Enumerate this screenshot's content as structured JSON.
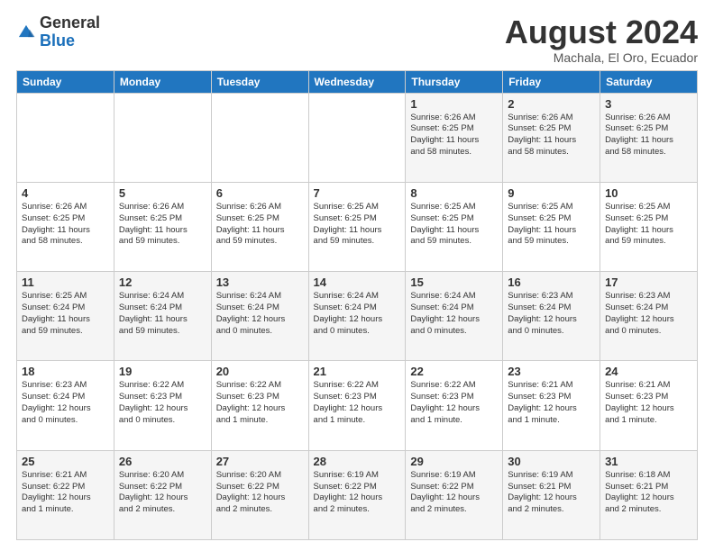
{
  "header": {
    "logo_general": "General",
    "logo_blue": "Blue",
    "month_title": "August 2024",
    "location": "Machala, El Oro, Ecuador"
  },
  "days_of_week": [
    "Sunday",
    "Monday",
    "Tuesday",
    "Wednesday",
    "Thursday",
    "Friday",
    "Saturday"
  ],
  "weeks": [
    [
      {
        "day": "",
        "info": ""
      },
      {
        "day": "",
        "info": ""
      },
      {
        "day": "",
        "info": ""
      },
      {
        "day": "",
        "info": ""
      },
      {
        "day": "1",
        "info": "Sunrise: 6:26 AM\nSunset: 6:25 PM\nDaylight: 11 hours\nand 58 minutes."
      },
      {
        "day": "2",
        "info": "Sunrise: 6:26 AM\nSunset: 6:25 PM\nDaylight: 11 hours\nand 58 minutes."
      },
      {
        "day": "3",
        "info": "Sunrise: 6:26 AM\nSunset: 6:25 PM\nDaylight: 11 hours\nand 58 minutes."
      }
    ],
    [
      {
        "day": "4",
        "info": "Sunrise: 6:26 AM\nSunset: 6:25 PM\nDaylight: 11 hours\nand 58 minutes."
      },
      {
        "day": "5",
        "info": "Sunrise: 6:26 AM\nSunset: 6:25 PM\nDaylight: 11 hours\nand 59 minutes."
      },
      {
        "day": "6",
        "info": "Sunrise: 6:26 AM\nSunset: 6:25 PM\nDaylight: 11 hours\nand 59 minutes."
      },
      {
        "day": "7",
        "info": "Sunrise: 6:25 AM\nSunset: 6:25 PM\nDaylight: 11 hours\nand 59 minutes."
      },
      {
        "day": "8",
        "info": "Sunrise: 6:25 AM\nSunset: 6:25 PM\nDaylight: 11 hours\nand 59 minutes."
      },
      {
        "day": "9",
        "info": "Sunrise: 6:25 AM\nSunset: 6:25 PM\nDaylight: 11 hours\nand 59 minutes."
      },
      {
        "day": "10",
        "info": "Sunrise: 6:25 AM\nSunset: 6:25 PM\nDaylight: 11 hours\nand 59 minutes."
      }
    ],
    [
      {
        "day": "11",
        "info": "Sunrise: 6:25 AM\nSunset: 6:24 PM\nDaylight: 11 hours\nand 59 minutes."
      },
      {
        "day": "12",
        "info": "Sunrise: 6:24 AM\nSunset: 6:24 PM\nDaylight: 11 hours\nand 59 minutes."
      },
      {
        "day": "13",
        "info": "Sunrise: 6:24 AM\nSunset: 6:24 PM\nDaylight: 12 hours\nand 0 minutes."
      },
      {
        "day": "14",
        "info": "Sunrise: 6:24 AM\nSunset: 6:24 PM\nDaylight: 12 hours\nand 0 minutes."
      },
      {
        "day": "15",
        "info": "Sunrise: 6:24 AM\nSunset: 6:24 PM\nDaylight: 12 hours\nand 0 minutes."
      },
      {
        "day": "16",
        "info": "Sunrise: 6:23 AM\nSunset: 6:24 PM\nDaylight: 12 hours\nand 0 minutes."
      },
      {
        "day": "17",
        "info": "Sunrise: 6:23 AM\nSunset: 6:24 PM\nDaylight: 12 hours\nand 0 minutes."
      }
    ],
    [
      {
        "day": "18",
        "info": "Sunrise: 6:23 AM\nSunset: 6:24 PM\nDaylight: 12 hours\nand 0 minutes."
      },
      {
        "day": "19",
        "info": "Sunrise: 6:22 AM\nSunset: 6:23 PM\nDaylight: 12 hours\nand 0 minutes."
      },
      {
        "day": "20",
        "info": "Sunrise: 6:22 AM\nSunset: 6:23 PM\nDaylight: 12 hours\nand 1 minute."
      },
      {
        "day": "21",
        "info": "Sunrise: 6:22 AM\nSunset: 6:23 PM\nDaylight: 12 hours\nand 1 minute."
      },
      {
        "day": "22",
        "info": "Sunrise: 6:22 AM\nSunset: 6:23 PM\nDaylight: 12 hours\nand 1 minute."
      },
      {
        "day": "23",
        "info": "Sunrise: 6:21 AM\nSunset: 6:23 PM\nDaylight: 12 hours\nand 1 minute."
      },
      {
        "day": "24",
        "info": "Sunrise: 6:21 AM\nSunset: 6:23 PM\nDaylight: 12 hours\nand 1 minute."
      }
    ],
    [
      {
        "day": "25",
        "info": "Sunrise: 6:21 AM\nSunset: 6:22 PM\nDaylight: 12 hours\nand 1 minute."
      },
      {
        "day": "26",
        "info": "Sunrise: 6:20 AM\nSunset: 6:22 PM\nDaylight: 12 hours\nand 2 minutes."
      },
      {
        "day": "27",
        "info": "Sunrise: 6:20 AM\nSunset: 6:22 PM\nDaylight: 12 hours\nand 2 minutes."
      },
      {
        "day": "28",
        "info": "Sunrise: 6:19 AM\nSunset: 6:22 PM\nDaylight: 12 hours\nand 2 minutes."
      },
      {
        "day": "29",
        "info": "Sunrise: 6:19 AM\nSunset: 6:22 PM\nDaylight: 12 hours\nand 2 minutes."
      },
      {
        "day": "30",
        "info": "Sunrise: 6:19 AM\nSunset: 6:21 PM\nDaylight: 12 hours\nand 2 minutes."
      },
      {
        "day": "31",
        "info": "Sunrise: 6:18 AM\nSunset: 6:21 PM\nDaylight: 12 hours\nand 2 minutes."
      }
    ]
  ]
}
